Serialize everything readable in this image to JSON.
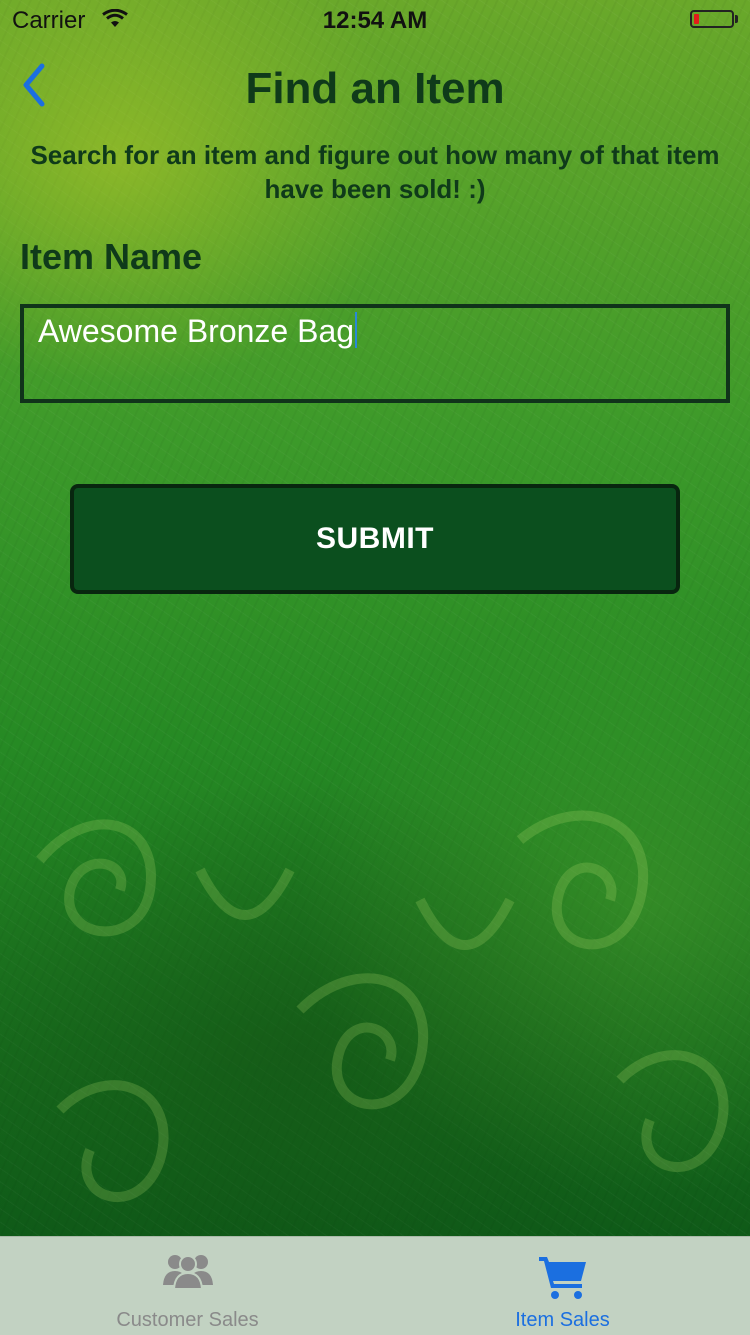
{
  "status_bar": {
    "carrier": "Carrier",
    "time": "12:54 AM",
    "battery_level": 0.15,
    "battery_color": "#e21b1b"
  },
  "nav": {
    "back_icon": "chevron-left-icon",
    "title": "Find an Item",
    "subtitle": "Search for an item and figure out how many of that item have been sold! :)"
  },
  "form": {
    "item_name_label": "Item Name",
    "item_name_value": "Awesome Bronze Bag",
    "submit_label": "SUBMIT"
  },
  "tab_bar": {
    "tabs": [
      {
        "label": "Customer Sales",
        "icon": "users-icon",
        "active": false,
        "color": "#8a8a8a"
      },
      {
        "label": "Item Sales",
        "icon": "cart-icon",
        "active": true,
        "color": "#1b6fe0"
      }
    ]
  },
  "colors": {
    "accent": "#1b6fe0",
    "dark_green": "#0b4f1e",
    "title_green": "#0f3a1a"
  }
}
